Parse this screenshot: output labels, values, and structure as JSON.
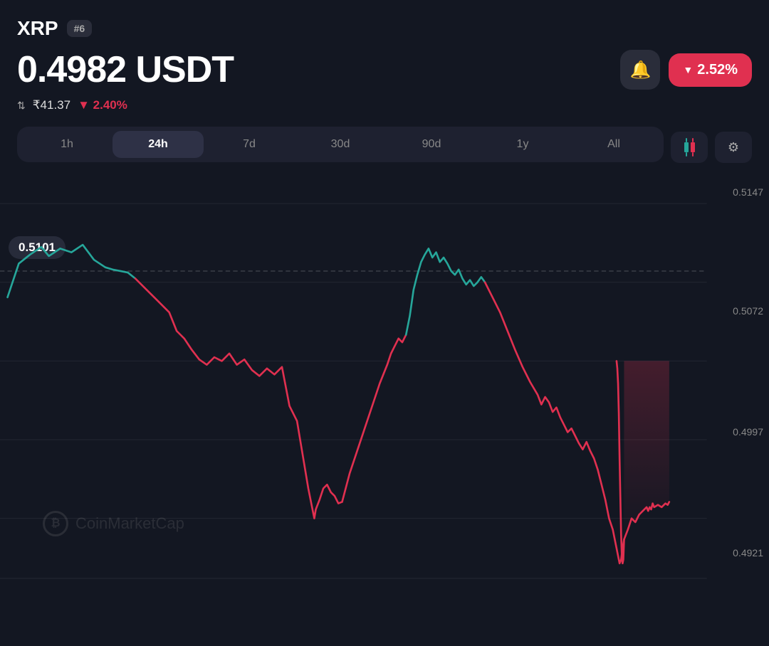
{
  "header": {
    "coin": "XRP",
    "rank": "#6",
    "price": "0.4982 USDT",
    "change_pct": "▼ 2.52%",
    "inr_price": "₹41.37",
    "inr_change": "▼ 2.40%"
  },
  "timeframes": [
    {
      "label": "1h",
      "active": false
    },
    {
      "label": "24h",
      "active": true
    },
    {
      "label": "7d",
      "active": false
    },
    {
      "label": "30d",
      "active": false
    },
    {
      "label": "90d",
      "active": false
    },
    {
      "label": "1y",
      "active": false
    },
    {
      "label": "All",
      "active": false
    }
  ],
  "chart": {
    "open_price": "0.5101",
    "price_levels": [
      {
        "value": "0.5147",
        "top_pct": 6
      },
      {
        "value": "0.5072",
        "top_pct": 34
      },
      {
        "value": "0.4997",
        "top_pct": 62
      },
      {
        "value": "0.4921",
        "top_pct": 90
      }
    ]
  },
  "watermark": "CoinMarketCap",
  "bell_label": "bell",
  "candle_label": "candlestick",
  "filter_label": "filter"
}
